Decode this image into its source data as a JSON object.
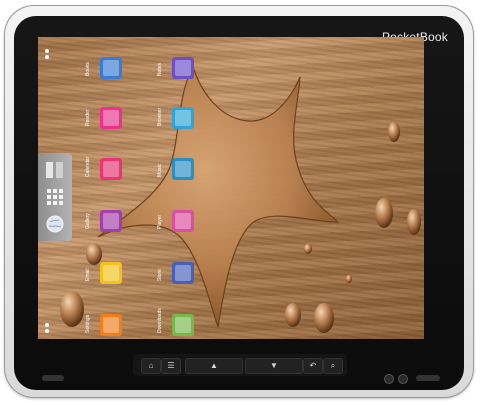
{
  "device": {
    "brand": "PocketBook"
  },
  "home_screen": {
    "apps_col1": [
      {
        "label": "Books",
        "icon": "books-icon",
        "color": "#3a7bd5"
      },
      {
        "label": "Reader",
        "icon": "reader-icon",
        "color": "#e8338f"
      },
      {
        "label": "Calendar",
        "icon": "calendar-icon",
        "color": "#e83575"
      },
      {
        "label": "Gallery",
        "icon": "gallery-icon",
        "color": "#a23fa8"
      },
      {
        "label": "Email",
        "icon": "email-icon",
        "color": "#f2c21a"
      },
      {
        "label": "Settings",
        "icon": "settings-icon",
        "color": "#f07f1b"
      }
    ],
    "apps_col2": [
      {
        "label": "Notes",
        "icon": "notes-icon",
        "color": "#6d4fc6"
      },
      {
        "label": "Browser",
        "icon": "browser-icon",
        "color": "#2ea5d6"
      },
      {
        "label": "Music",
        "icon": "music-icon",
        "color": "#2a8fc3"
      },
      {
        "label": "Player",
        "icon": "player-icon",
        "color": "#d94fa1"
      },
      {
        "label": "Store",
        "icon": "store-icon",
        "color": "#4760b8"
      },
      {
        "label": "Downloads",
        "icon": "downloads-icon",
        "color": "#78b84a"
      }
    ]
  },
  "controls": {
    "up": "▲",
    "down": "▼",
    "back": "↶",
    "search": "⌕",
    "menu": "☰",
    "home": "⌂"
  }
}
